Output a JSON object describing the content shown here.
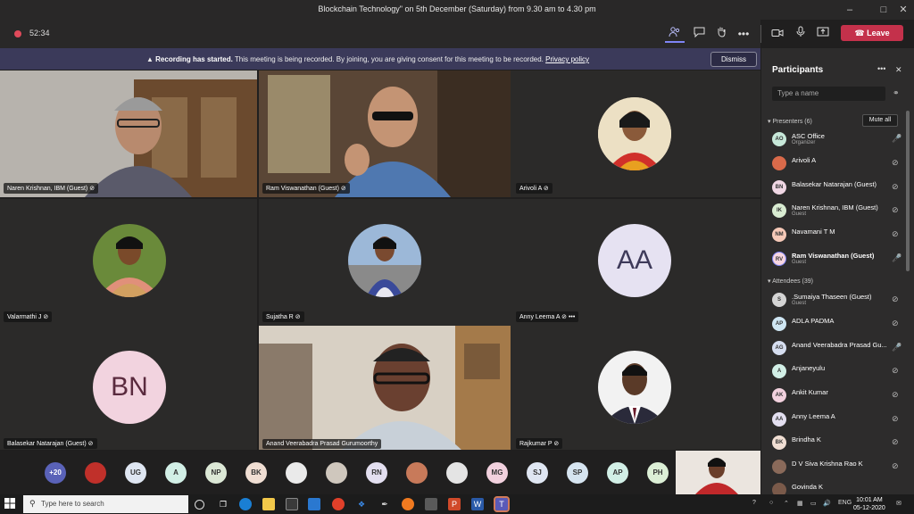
{
  "window": {
    "title": "Blockchain Technology\" on 5th December (Saturday) from 9.30 am to 4.30 pm",
    "minimize": "–",
    "maximize": "□",
    "close": "✕"
  },
  "toolbar": {
    "timer": "52:34",
    "icons": [
      "people-icon",
      "chat-icon",
      "raise-hand-icon",
      "more-icon",
      "camera-icon",
      "mic-icon",
      "share-icon"
    ],
    "more_label": "•••",
    "leave_label": "Leave"
  },
  "banner": {
    "bold": "Recording has started.",
    "text": "This meeting is being recorded. By joining, you are giving consent for this meeting to be recorded.",
    "link": "Privacy policy",
    "dismiss": "Dismiss"
  },
  "tiles": [
    {
      "label": "Naren Krishnan, IBM (Guest)",
      "kind": "video"
    },
    {
      "label": "Ram Viswanathan (Guest)",
      "kind": "video"
    },
    {
      "label": "Arivoli A",
      "kind": "photo"
    },
    {
      "label": "Valarmathi J",
      "kind": "photo"
    },
    {
      "label": "Sujatha R",
      "kind": "photo"
    },
    {
      "label": "Anny Leema A",
      "kind": "initials",
      "initials": "AA"
    },
    {
      "label": "Balasekar Natarajan (Guest)",
      "kind": "initials",
      "initials": "BN"
    },
    {
      "label": "Anand Veerabadra Prasad Gurumoorthy",
      "kind": "video"
    },
    {
      "label": "Rajkumar P",
      "kind": "photo"
    }
  ],
  "tile_more": "•••",
  "strip": {
    "overflow": "+20",
    "avatars": [
      "",
      "UG",
      "A",
      "NP",
      "BK",
      "",
      "",
      "RN",
      "",
      "",
      "MG",
      "SJ",
      "SP",
      "AP",
      "PH"
    ]
  },
  "participants": {
    "title": "Participants",
    "more": "•••",
    "close": "✕",
    "search_placeholder": "Type a name",
    "presenters_label": "Presenters (6)",
    "mute_all": "Mute all",
    "presenters": [
      {
        "initials": "AO",
        "name": "ASC Office",
        "sub": "Organizer",
        "color": "#c7e8d9"
      },
      {
        "initials": "",
        "name": "Arivoli A",
        "sub": "",
        "color": "#d96a4a"
      },
      {
        "initials": "BN",
        "name": "Balasekar Natarajan (Guest)",
        "sub": "",
        "color": "#f0d7e4"
      },
      {
        "initials": "IK",
        "name": "Naren Krishnan, IBM (Guest)",
        "sub": "Guest",
        "color": "#d9ecd2"
      },
      {
        "initials": "NM",
        "name": "Navamani T M",
        "sub": "",
        "color": "#f6c9b8"
      },
      {
        "initials": "RV",
        "name": "Ram Viswanathan (Guest)",
        "sub": "Guest",
        "color": "#f7d6e0"
      }
    ],
    "attendees_label": "Attendees (39)",
    "attendees": [
      {
        "initials": "S",
        "name": ".Sumaiya Thaseen (Guest)",
        "sub": "Guest",
        "color": "#d4d4d4"
      },
      {
        "initials": "AP",
        "name": "ADLA PADMA",
        "sub": "",
        "color": "#cfe6f3"
      },
      {
        "initials": "AG",
        "name": "Anand Veerabadra Prasad Gu...",
        "sub": "",
        "color": "#d6def0"
      },
      {
        "initials": "A",
        "name": "Anjaneyulu",
        "sub": "",
        "color": "#d2efe6"
      },
      {
        "initials": "AK",
        "name": "Ankit Kumar",
        "sub": "",
        "color": "#f2d1de"
      },
      {
        "initials": "AA",
        "name": "Anny Leema A",
        "sub": "",
        "color": "#e3dff0"
      },
      {
        "initials": "BK",
        "name": "Brindha K",
        "sub": "",
        "color": "#f0ded3"
      },
      {
        "initials": "",
        "name": "D V Siva Krishna Rao K",
        "sub": "",
        "color": "#8a6a5a"
      },
      {
        "initials": "",
        "name": "Govinda K",
        "sub": "",
        "color": "#7a5a4a"
      }
    ]
  },
  "taskbar": {
    "search_placeholder": "Type here to search",
    "lang": "ENG",
    "time": "10:01 AM",
    "date": "05-12-2020"
  }
}
